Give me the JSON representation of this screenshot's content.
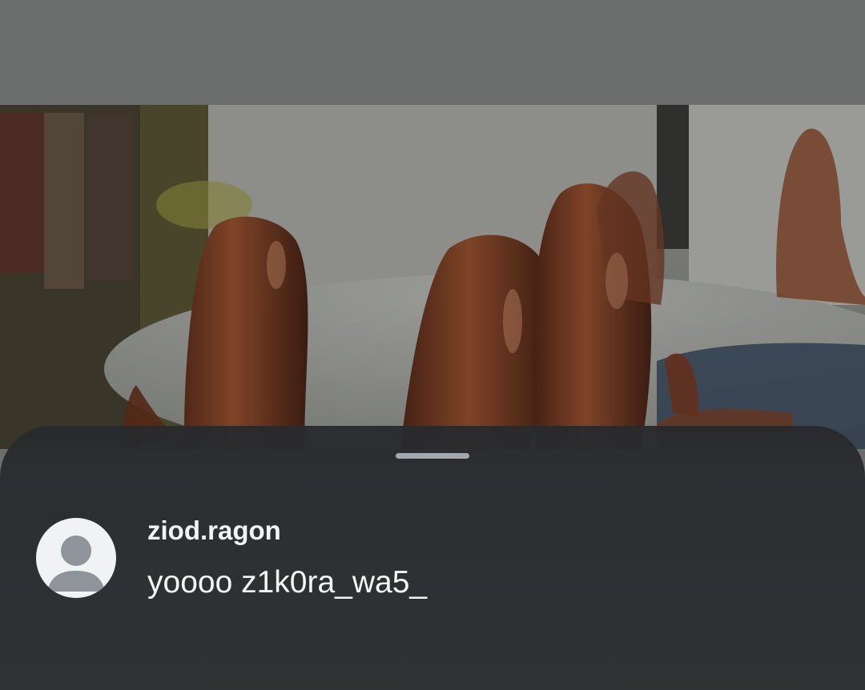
{
  "media": {
    "icon": "photo-background",
    "subject": "sausages"
  },
  "sheet": {
    "handle_icon": "drag-handle"
  },
  "comment": {
    "avatar_icon": "default-avatar-icon",
    "username": "ziod.ragon",
    "text": "yoooo z1k0ra_wa5_"
  },
  "colors": {
    "sheet_background": "#2b2d30",
    "text_primary": "#f2f3f5",
    "handle": "#a3a8ae",
    "avatar_background": "#f1f2f4",
    "avatar_figure": "#8f949b",
    "top_band": "#6a6d6b"
  }
}
